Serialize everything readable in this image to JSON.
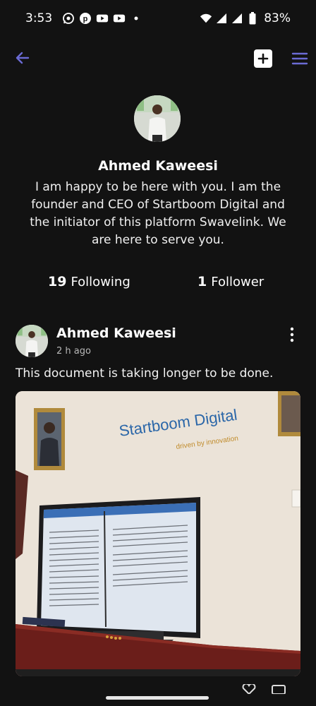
{
  "status_bar": {
    "time": "3:53",
    "battery": "83%",
    "notification_icons": [
      "whatsapp-icon",
      "pinterest-icon",
      "youtube-icon",
      "youtube-icon",
      "dot-icon"
    ]
  },
  "app_bar": {
    "icons": [
      "back-arrow-icon",
      "add-post-icon",
      "hamburger-menu-icon"
    ],
    "accent_color": "#6b6bd4"
  },
  "profile": {
    "name": "Ahmed Kaweesi",
    "bio": "I am happy to be here with you. I am the founder and CEO of Startboom Digital and the initiator of this platform Swavelink. We are here to serve you.",
    "following_count": "19",
    "following_label": "Following",
    "followers_count": "1",
    "followers_label": "Follower"
  },
  "post": {
    "author": "Ahmed Kaweesi",
    "time": "2 h ago",
    "text": "This document is taking longer to be done.",
    "image_sign_text": "Startboom Digital",
    "image_sign_tagline": "driven by innovation"
  }
}
